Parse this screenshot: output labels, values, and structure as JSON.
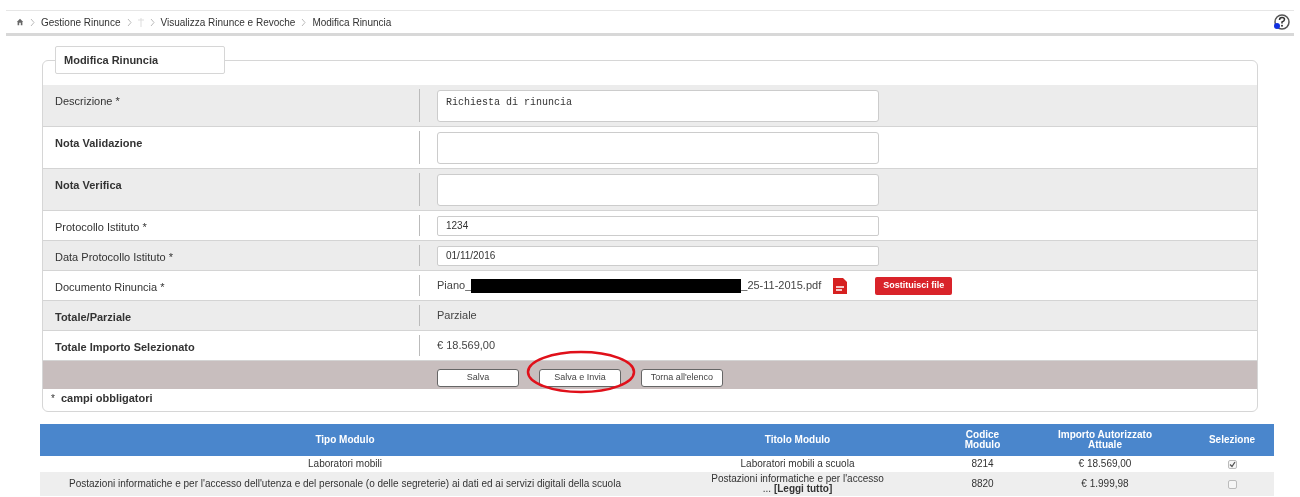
{
  "breadcrumb": [
    "Gestione Rinunce",
    "Visualizza Rinunce e Revoche",
    "Modifica Rinuncia"
  ],
  "form": {
    "legend": "Modifica Rinuncia",
    "fields": [
      {
        "label": "Descrizione *",
        "bold": false,
        "kind": "textarea",
        "value": "Richiesta di rinuncia"
      },
      {
        "label": "Nota Validazione",
        "bold": true,
        "kind": "textarea"
      },
      {
        "label": "Nota Verifica",
        "bold": true,
        "kind": "textarea"
      },
      {
        "label": "Protocollo Istituto *",
        "bold": false,
        "kind": "input",
        "value": "1234"
      },
      {
        "label": "Data Protocollo Istituto *",
        "bold": false,
        "kind": "input",
        "value": "01/11/2016"
      },
      {
        "label": "Documento Rinuncia *",
        "bold": false,
        "kind": "file",
        "file_prefix": "Piano_",
        "file_suffix": "_25-11-2015.pdf",
        "action": "Sostituisci file"
      },
      {
        "label": "Totale/Parziale",
        "bold": true,
        "kind": "text",
        "value": "Parziale"
      },
      {
        "label": "Totale Importo Selezionato",
        "bold": true,
        "kind": "text",
        "value": "€ 18.569,00"
      }
    ],
    "buttons": [
      {
        "label": "Salva",
        "circled": false
      },
      {
        "label": "Salva e Invia",
        "circled": true
      },
      {
        "label": "Torna all'elenco",
        "circled": false
      }
    ],
    "note": "campi obbligatori",
    "note_mark": "*"
  },
  "table": {
    "columns": [
      "Tipo Modulo",
      "Titolo Modulo",
      "Codice Modulo",
      "Importo Autorizzato Attuale",
      "Selezione"
    ],
    "rows": [
      {
        "tipo": "Laboratori mobili",
        "titolo": "Laboratori mobili a scuola",
        "codice": "8214",
        "importo": "€ 18.569,00",
        "selected": true
      },
      {
        "tipo": "Postazioni informatiche e per l'accesso dell'utenza e del personale (o delle segreterie) ai dati ed ai servizi digitali della scuola",
        "titolo": "Postazioni informatiche e per l'accesso ...",
        "link": "[Leggi tutto]",
        "codice": "8820",
        "importo": "€ 1.999,98",
        "selected": false
      }
    ]
  }
}
